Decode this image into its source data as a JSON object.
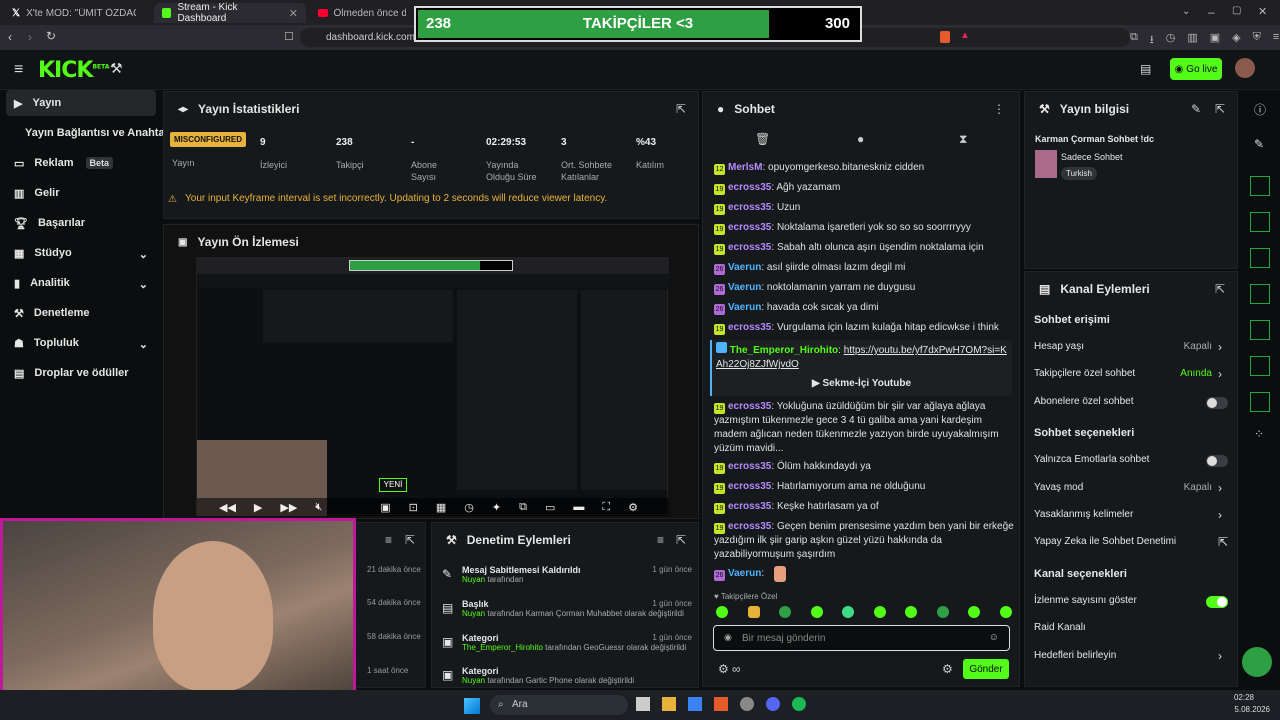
{
  "browser": {
    "tabs": [
      {
        "title": "X'te MOD: \"ÜMİT ÖZDAĞ'DAN YENİ"
      },
      {
        "title": "Stream - Kick Dashboard"
      },
      {
        "title": "Ölmeden önce dinlenen"
      }
    ],
    "url": "dashboard.kick.com/str"
  },
  "overlay": {
    "current": "238",
    "label": "TAKİPÇİLER <3",
    "goal": "300",
    "progress": 0.79
  },
  "header": {
    "logo": "KICK",
    "logo_sup": "BETA",
    "go_live": "Go live"
  },
  "sidebar": {
    "items": [
      {
        "label": "Yayın"
      },
      {
        "label": "Yayın Bağlantısı ve Anahtarı"
      },
      {
        "label": "Reklam",
        "badge": "Beta"
      },
      {
        "label": "Gelir"
      },
      {
        "label": "Başarılar"
      },
      {
        "label": "Stüdyo"
      },
      {
        "label": "Analitik"
      },
      {
        "label": "Denetleme"
      },
      {
        "label": "Topluluk"
      },
      {
        "label": "Droplar ve ödüller"
      }
    ]
  },
  "stats": {
    "title": "Yayın İstatistikleri",
    "status": "MISCONFIGURED",
    "status_label": "Yayın",
    "items": [
      {
        "value": "9",
        "label": "İzleyici"
      },
      {
        "value": "238",
        "label": "Takipçi"
      },
      {
        "value": "-",
        "label": "Abone Sayısı"
      },
      {
        "value": "02:29:53",
        "label": "Yayında Olduğu Süre"
      },
      {
        "value": "3",
        "label": "Ort. Sohbete Katılanlar"
      },
      {
        "value": "%43",
        "label": "Katılım"
      }
    ],
    "warning": "Your input Keyframe interval is set incorrectly. Updating to 2 seconds will reduce viewer latency."
  },
  "preview": {
    "title": "Yayın Ön İzlemesi",
    "new_badge": "YENİ"
  },
  "moderation": {
    "title": "Denetim Eylemleri",
    "left_times": [
      "21 dakika önce",
      "54 dakika önce",
      "58 dakika önce",
      "1 saat önce"
    ],
    "items": [
      {
        "title": "Mesaj Sabitlemesi Kaldırıldı",
        "user": "Nuyan",
        "rest": "tarafından",
        "time": "1 gün önce"
      },
      {
        "title": "Başlık",
        "user": "Nuyan",
        "rest": "tarafından Karman Çorman Muhabbet olarak değiştirildi",
        "time": "1 gün önce"
      },
      {
        "title": "Kategori",
        "user": "The_Emperor_Hirohito",
        "rest": "tarafından GeoGuessr olarak değiştirildi",
        "time": "1 gün önce"
      },
      {
        "title": "Kategori",
        "user": "Nuyan",
        "rest": "tarafından Gartic Phone olarak değiştirildi",
        "time": "1 gün önce"
      }
    ]
  },
  "chat": {
    "title": "Sohbet",
    "messages": [
      {
        "badge": "12",
        "user": "MerlsM",
        "color": "p",
        "text": "opuyomgerkeso.bitaneskniz cidden"
      },
      {
        "badge": "19",
        "user": "ecross35",
        "color": "p",
        "text": "Ağh yazamam"
      },
      {
        "badge": "19",
        "user": "ecross35",
        "color": "p",
        "text": "Uzun"
      },
      {
        "badge": "19",
        "user": "ecross35",
        "color": "p",
        "text": "Noktalama işaretleri yok so so so soorrrryyy"
      },
      {
        "badge": "19",
        "user": "ecross35",
        "color": "p",
        "text": "Sabah altı olunca aşırı üşendim noktalama için"
      },
      {
        "badge": "26",
        "user": "Vaerun",
        "color": "c",
        "text": "asıl şiirde olması lazım degil mi"
      },
      {
        "badge": "26",
        "user": "Vaerun",
        "color": "c",
        "text": "noktolamanın yarram ne duygusu"
      },
      {
        "badge": "26",
        "user": "Vaerun",
        "color": "c",
        "text": "havada cok sıcak ya dimi"
      },
      {
        "badge": "19",
        "user": "ecross35",
        "color": "p",
        "text": "Vurgulama için lazım kulağa hitap edicwkse i think"
      }
    ],
    "link_user": "The_Emperor_Hirohito",
    "link_url": "https://youtu.be/yf7dxPwH7OM?si=KAh22Oj8ZJfWjvdO",
    "link_button": "Sekme-İçi Youtube",
    "messages2": [
      {
        "badge": "19",
        "user": "ecross35",
        "color": "p",
        "text": "Yokluğuna üzüldüğüm bir şiir var ağlaya ağlaya yazmıştım tükenmezle gece 3 4 tü galiba ama yani kardeşim madem ağlıcan neden tükenmezle yazıyon birde uyuyakalmışım yüzüm mavidi..."
      },
      {
        "badge": "19",
        "user": "ecross35",
        "color": "p",
        "text": "Ölüm hakkındaydı ya"
      },
      {
        "badge": "19",
        "user": "ecross35",
        "color": "p",
        "text": "Hatırlamıyorum ama ne olduğunu"
      },
      {
        "badge": "19",
        "user": "ecross35",
        "color": "p",
        "text": "Keşke hatırlasam ya of"
      },
      {
        "badge": "19",
        "user": "ecross35",
        "color": "p",
        "text": "Geçen benim prensesime yazdım ben yani bir erkeğe yazdığım ilk şiir garip aşkın güzel yüzü hakkında da yazabiliyormuşum şaşırdım"
      },
      {
        "badge": "26",
        "user": "Vaerun",
        "color": "c",
        "text": ""
      }
    ],
    "followers_only": "Takipçilere Özel",
    "placeholder": "Bir mesaj gönderin",
    "send": "Gönder"
  },
  "info": {
    "title": "Yayın bilgisi",
    "stream_title": "Karman Çorman Sohbet !dc",
    "category": "Sadece Sohbet",
    "language": "Turkish"
  },
  "channel": {
    "title": "Kanal Eylemleri",
    "chat_access": "Sohbet erişimi",
    "rows1": [
      {
        "label": "Hesap yaşı",
        "value": "Kapalı",
        "kind": "arrow"
      },
      {
        "label": "Takipçilere özel sohbet",
        "value": "Anında",
        "kind": "arrow-green"
      },
      {
        "label": "Abonelere özel sohbet",
        "value": "",
        "kind": "toggle-off"
      }
    ],
    "chat_options": "Sohbet seçenekleri",
    "rows2": [
      {
        "label": "Yalnızca Emotlarla sohbet",
        "value": "",
        "kind": "toggle-off"
      },
      {
        "label": "Yavaş mod",
        "value": "Kapalı",
        "kind": "arrow"
      },
      {
        "label": "Yasaklanmış kelimeler",
        "value": "",
        "kind": "arrow"
      },
      {
        "label": "Yapay Zeka ile Sohbet Denetimi",
        "value": "",
        "kind": "ext"
      }
    ],
    "channel_options": "Kanal seçenekleri",
    "rows3": [
      {
        "label": "İzlenme sayısını göster",
        "value": "",
        "kind": "toggle-on"
      },
      {
        "label": "Raid Kanalı",
        "value": "",
        "kind": "none"
      },
      {
        "label": "Hedefleri belirleyin",
        "value": "",
        "kind": "arrow"
      }
    ]
  },
  "taskbar": {
    "search": "Ara",
    "time": "02:28",
    "date": "5.08.2026"
  },
  "colors": {
    "accent": "#53fc18",
    "warning": "#e8b23d",
    "misconfigured": "#e8b23d"
  }
}
